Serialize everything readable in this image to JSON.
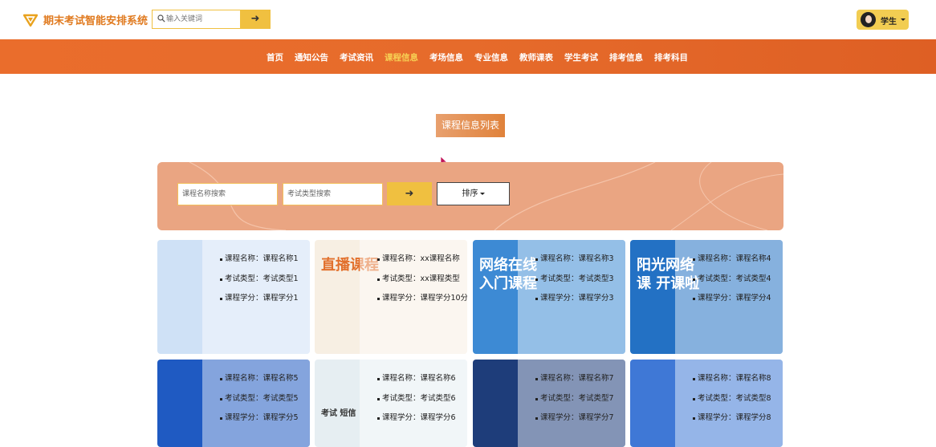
{
  "header": {
    "brand": "期末考试智能安排系统",
    "search_placeholder": "输入关键词",
    "search_button": "➜",
    "user_label": "学生"
  },
  "nav": {
    "items": [
      {
        "label": "首页",
        "active": false
      },
      {
        "label": "通知公告",
        "active": false
      },
      {
        "label": "考试资讯",
        "active": false
      },
      {
        "label": "课程信息",
        "active": true
      },
      {
        "label": "考场信息",
        "active": false
      },
      {
        "label": "专业信息",
        "active": false
      },
      {
        "label": "教师课表",
        "active": false
      },
      {
        "label": "学生考试",
        "active": false
      },
      {
        "label": "排考信息",
        "active": false
      },
      {
        "label": "排考科目",
        "active": false
      }
    ]
  },
  "page": {
    "title": "课程信息列表"
  },
  "filter": {
    "course_name_placeholder": "课程名称搜索",
    "exam_type_placeholder": "考试类型搜索",
    "search_button": "➜",
    "sort_label": "排序"
  },
  "cards": [
    {
      "name": "课程名称：课程名称1",
      "type": "考试类型：考试类型1",
      "credit": "课程学分：课程学分1",
      "thumb_text": "",
      "thumb_color": "#cfe1f6"
    },
    {
      "name": "课程名称：xx课程名称",
      "type": "考试类型：xx课程类型",
      "credit": "课程学分：课程学分10分",
      "thumb_text": "直播课程",
      "thumb_color": "#f7efe3"
    },
    {
      "name": "课程名称：课程名称3",
      "type": "考试类型：考试类型3",
      "credit": "课程学分：课程学分3",
      "thumb_text": "网络在线 入门课程",
      "thumb_color": "#3d8ad4"
    },
    {
      "name": "课程名称：课程名称4",
      "type": "考试类型：考试类型4",
      "credit": "课程学分：课程学分4",
      "thumb_text": "阳光网络课 开课啦",
      "thumb_color": "#2371c4"
    },
    {
      "name": "课程名称：课程名称5",
      "type": "考试类型：考试类型5",
      "credit": "课程学分：课程学分5",
      "thumb_text": "",
      "thumb_color": "#1f5ac2"
    },
    {
      "name": "课程名称：课程名称6",
      "type": "考试类型：考试类型6",
      "credit": "课程学分：课程学分6",
      "thumb_text": "考试 短信",
      "thumb_color": "#e6eef2"
    },
    {
      "name": "课程名称：课程名称7",
      "type": "考试类型：考试类型7",
      "credit": "课程学分：课程学分7",
      "thumb_text": "",
      "thumb_color": "#1e3d7a"
    },
    {
      "name": "课程名称：课程名称8",
      "type": "考试类型：考试类型8",
      "credit": "课程学分：课程学分8",
      "thumb_text": "",
      "thumb_color": "#3f78d6"
    }
  ]
}
